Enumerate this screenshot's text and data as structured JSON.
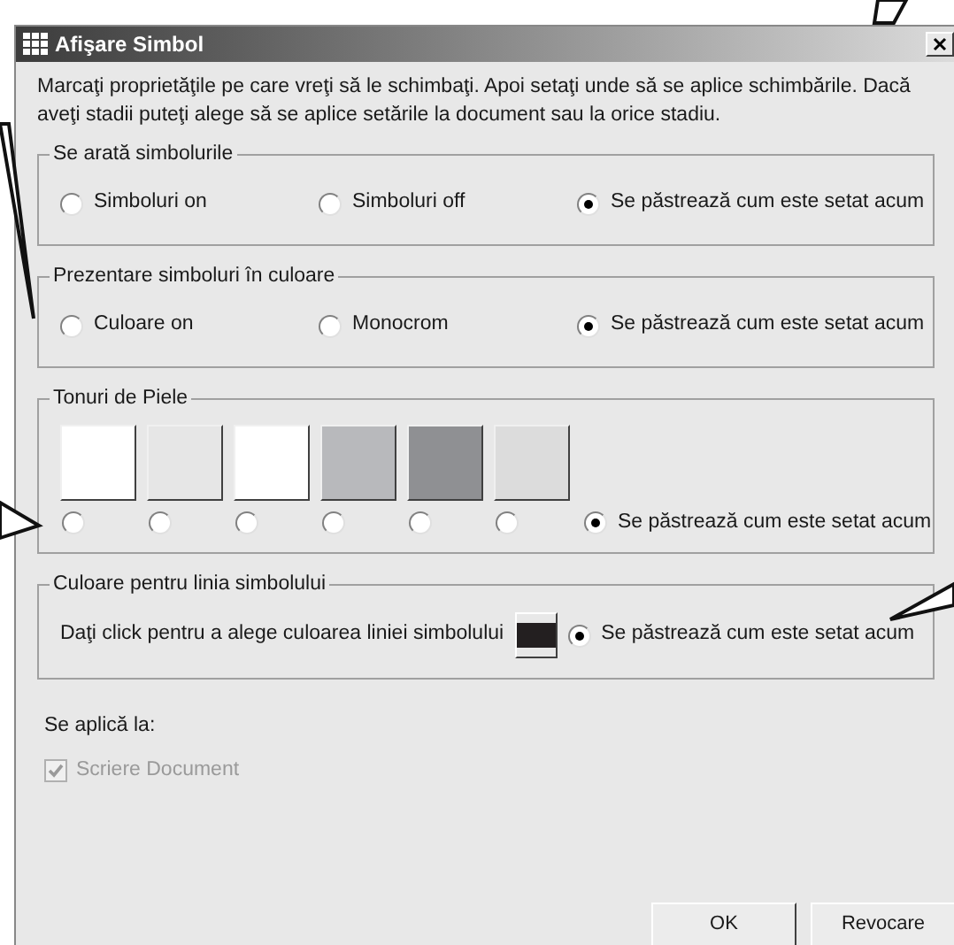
{
  "window": {
    "title": "Afişare Simbol"
  },
  "intro": "Marcaţi proprietăţile pe care vreţi să le schimbaţi. Apoi setaţi unde să se aplice schimbările. Dacă aveţi stadii puteţi alege să se aplice setările la document sau la orice stadiu.",
  "groups": [
    {
      "kind": "radio",
      "title": "Se arată simbolurile",
      "options": [
        {
          "label": "Simboluri on",
          "selected": false
        },
        {
          "label": "Simboluri off",
          "selected": false
        },
        {
          "label": "Se păstrează cum este setat acum",
          "selected": true
        }
      ]
    },
    {
      "kind": "radio",
      "title": "Prezentare simboluri în culoare",
      "options": [
        {
          "label": "Culoare on",
          "selected": false
        },
        {
          "label": "Monocrom",
          "selected": false
        },
        {
          "label": "Se păstrează cum este setat acum",
          "selected": true
        }
      ]
    },
    {
      "kind": "swatches",
      "title": "Tonuri de Piele",
      "swatches": [
        {
          "color": "#ffffff",
          "selected": false
        },
        {
          "color": "#e6e6e6",
          "selected": false
        },
        {
          "color": "#ffffff",
          "selected": false
        },
        {
          "color": "#b8b9bc",
          "selected": false
        },
        {
          "color": "#8f9093",
          "selected": false
        },
        {
          "color": "#dcdcdc",
          "selected": false
        }
      ],
      "options": [
        {
          "label": "Se păstrează cum este setat acum",
          "selected": true
        }
      ]
    },
    {
      "kind": "line_color",
      "title": "Culoare pentru linia simbolului",
      "prompt": "Daţi click pentru a alege culoarea liniei simbolului",
      "color": "#231f20",
      "options": [
        {
          "label": "Se păstrează cum este setat acum",
          "selected": true
        }
      ]
    }
  ],
  "applies_to": {
    "label": "Se aplică la:",
    "checkbox": {
      "label": "Scriere Document",
      "checked": true,
      "disabled": true
    }
  },
  "buttons": [
    "OK",
    "Revocare"
  ]
}
